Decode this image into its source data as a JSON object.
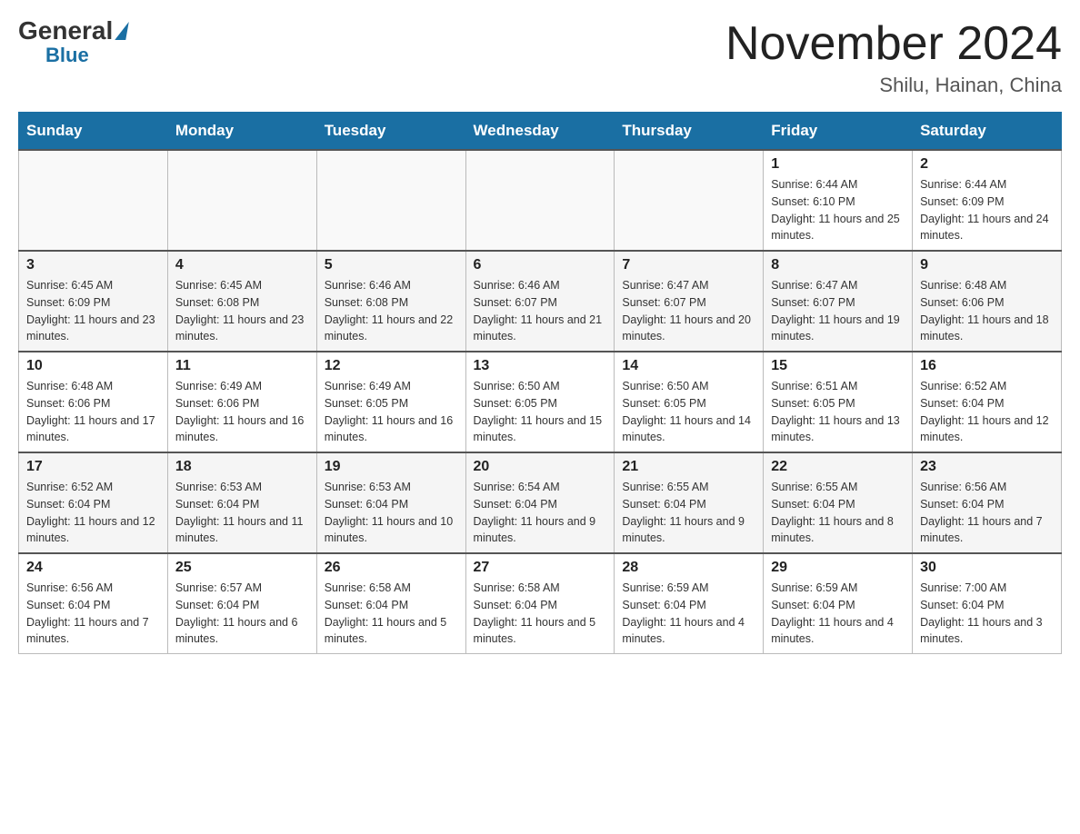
{
  "header": {
    "logo_general": "General",
    "logo_blue": "Blue",
    "month_title": "November 2024",
    "location": "Shilu, Hainan, China"
  },
  "days_of_week": [
    "Sunday",
    "Monday",
    "Tuesday",
    "Wednesday",
    "Thursday",
    "Friday",
    "Saturday"
  ],
  "weeks": [
    [
      null,
      null,
      null,
      null,
      null,
      {
        "day": "1",
        "sunrise": "Sunrise: 6:44 AM",
        "sunset": "Sunset: 6:10 PM",
        "daylight": "Daylight: 11 hours and 25 minutes."
      },
      {
        "day": "2",
        "sunrise": "Sunrise: 6:44 AM",
        "sunset": "Sunset: 6:09 PM",
        "daylight": "Daylight: 11 hours and 24 minutes."
      }
    ],
    [
      {
        "day": "3",
        "sunrise": "Sunrise: 6:45 AM",
        "sunset": "Sunset: 6:09 PM",
        "daylight": "Daylight: 11 hours and 23 minutes."
      },
      {
        "day": "4",
        "sunrise": "Sunrise: 6:45 AM",
        "sunset": "Sunset: 6:08 PM",
        "daylight": "Daylight: 11 hours and 23 minutes."
      },
      {
        "day": "5",
        "sunrise": "Sunrise: 6:46 AM",
        "sunset": "Sunset: 6:08 PM",
        "daylight": "Daylight: 11 hours and 22 minutes."
      },
      {
        "day": "6",
        "sunrise": "Sunrise: 6:46 AM",
        "sunset": "Sunset: 6:07 PM",
        "daylight": "Daylight: 11 hours and 21 minutes."
      },
      {
        "day": "7",
        "sunrise": "Sunrise: 6:47 AM",
        "sunset": "Sunset: 6:07 PM",
        "daylight": "Daylight: 11 hours and 20 minutes."
      },
      {
        "day": "8",
        "sunrise": "Sunrise: 6:47 AM",
        "sunset": "Sunset: 6:07 PM",
        "daylight": "Daylight: 11 hours and 19 minutes."
      },
      {
        "day": "9",
        "sunrise": "Sunrise: 6:48 AM",
        "sunset": "Sunset: 6:06 PM",
        "daylight": "Daylight: 11 hours and 18 minutes."
      }
    ],
    [
      {
        "day": "10",
        "sunrise": "Sunrise: 6:48 AM",
        "sunset": "Sunset: 6:06 PM",
        "daylight": "Daylight: 11 hours and 17 minutes."
      },
      {
        "day": "11",
        "sunrise": "Sunrise: 6:49 AM",
        "sunset": "Sunset: 6:06 PM",
        "daylight": "Daylight: 11 hours and 16 minutes."
      },
      {
        "day": "12",
        "sunrise": "Sunrise: 6:49 AM",
        "sunset": "Sunset: 6:05 PM",
        "daylight": "Daylight: 11 hours and 16 minutes."
      },
      {
        "day": "13",
        "sunrise": "Sunrise: 6:50 AM",
        "sunset": "Sunset: 6:05 PM",
        "daylight": "Daylight: 11 hours and 15 minutes."
      },
      {
        "day": "14",
        "sunrise": "Sunrise: 6:50 AM",
        "sunset": "Sunset: 6:05 PM",
        "daylight": "Daylight: 11 hours and 14 minutes."
      },
      {
        "day": "15",
        "sunrise": "Sunrise: 6:51 AM",
        "sunset": "Sunset: 6:05 PM",
        "daylight": "Daylight: 11 hours and 13 minutes."
      },
      {
        "day": "16",
        "sunrise": "Sunrise: 6:52 AM",
        "sunset": "Sunset: 6:04 PM",
        "daylight": "Daylight: 11 hours and 12 minutes."
      }
    ],
    [
      {
        "day": "17",
        "sunrise": "Sunrise: 6:52 AM",
        "sunset": "Sunset: 6:04 PM",
        "daylight": "Daylight: 11 hours and 12 minutes."
      },
      {
        "day": "18",
        "sunrise": "Sunrise: 6:53 AM",
        "sunset": "Sunset: 6:04 PM",
        "daylight": "Daylight: 11 hours and 11 minutes."
      },
      {
        "day": "19",
        "sunrise": "Sunrise: 6:53 AM",
        "sunset": "Sunset: 6:04 PM",
        "daylight": "Daylight: 11 hours and 10 minutes."
      },
      {
        "day": "20",
        "sunrise": "Sunrise: 6:54 AM",
        "sunset": "Sunset: 6:04 PM",
        "daylight": "Daylight: 11 hours and 9 minutes."
      },
      {
        "day": "21",
        "sunrise": "Sunrise: 6:55 AM",
        "sunset": "Sunset: 6:04 PM",
        "daylight": "Daylight: 11 hours and 9 minutes."
      },
      {
        "day": "22",
        "sunrise": "Sunrise: 6:55 AM",
        "sunset": "Sunset: 6:04 PM",
        "daylight": "Daylight: 11 hours and 8 minutes."
      },
      {
        "day": "23",
        "sunrise": "Sunrise: 6:56 AM",
        "sunset": "Sunset: 6:04 PM",
        "daylight": "Daylight: 11 hours and 7 minutes."
      }
    ],
    [
      {
        "day": "24",
        "sunrise": "Sunrise: 6:56 AM",
        "sunset": "Sunset: 6:04 PM",
        "daylight": "Daylight: 11 hours and 7 minutes."
      },
      {
        "day": "25",
        "sunrise": "Sunrise: 6:57 AM",
        "sunset": "Sunset: 6:04 PM",
        "daylight": "Daylight: 11 hours and 6 minutes."
      },
      {
        "day": "26",
        "sunrise": "Sunrise: 6:58 AM",
        "sunset": "Sunset: 6:04 PM",
        "daylight": "Daylight: 11 hours and 5 minutes."
      },
      {
        "day": "27",
        "sunrise": "Sunrise: 6:58 AM",
        "sunset": "Sunset: 6:04 PM",
        "daylight": "Daylight: 11 hours and 5 minutes."
      },
      {
        "day": "28",
        "sunrise": "Sunrise: 6:59 AM",
        "sunset": "Sunset: 6:04 PM",
        "daylight": "Daylight: 11 hours and 4 minutes."
      },
      {
        "day": "29",
        "sunrise": "Sunrise: 6:59 AM",
        "sunset": "Sunset: 6:04 PM",
        "daylight": "Daylight: 11 hours and 4 minutes."
      },
      {
        "day": "30",
        "sunrise": "Sunrise: 7:00 AM",
        "sunset": "Sunset: 6:04 PM",
        "daylight": "Daylight: 11 hours and 3 minutes."
      }
    ]
  ]
}
